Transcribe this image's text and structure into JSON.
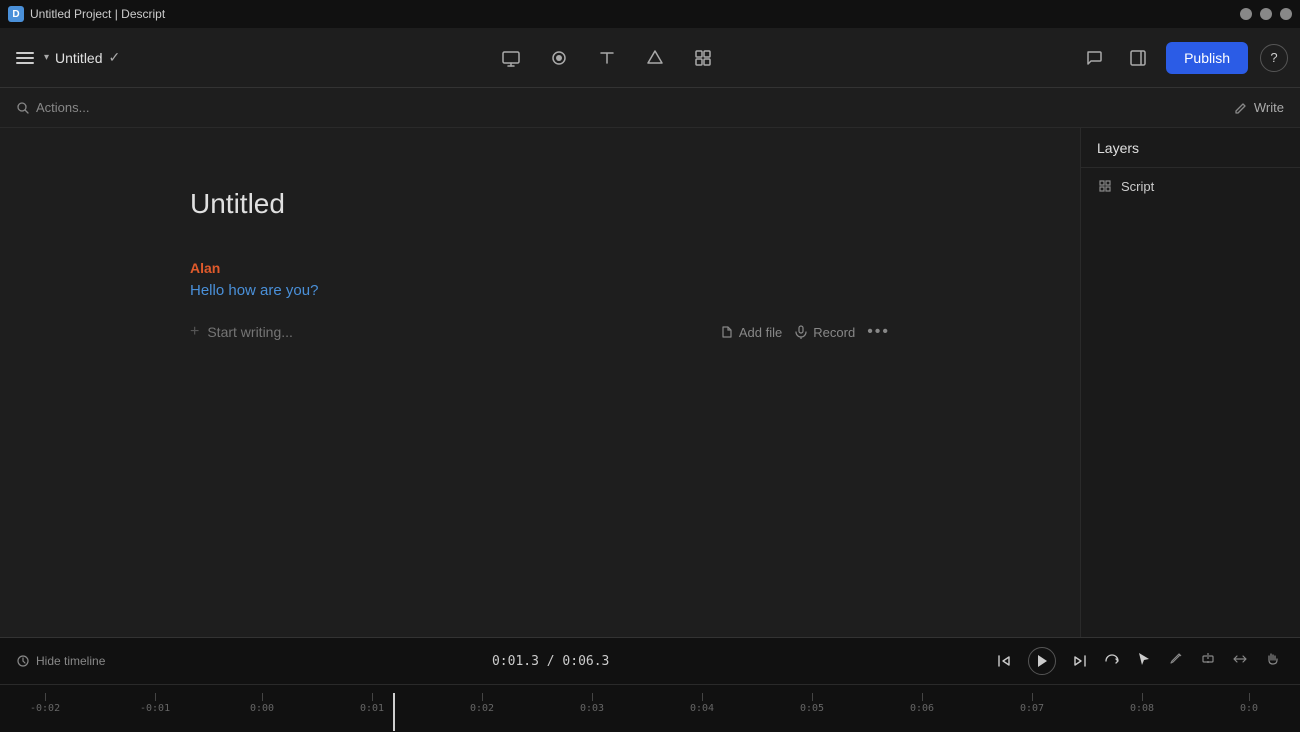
{
  "window": {
    "title": "Untitled Project | Descript",
    "icon_label": "D"
  },
  "toolbar": {
    "project_name": "Untitled",
    "check_icon": "✓",
    "chevron": "▾",
    "publish_label": "Publish",
    "help_label": "?",
    "icons": {
      "camera": "⬛",
      "record": "⏺",
      "text": "T",
      "shape": "◇",
      "grid": "⊞",
      "comment": "💬",
      "panel": "⊡"
    }
  },
  "actions_bar": {
    "search_label": "Actions...",
    "write_label": "Write"
  },
  "editor": {
    "doc_title": "Untitled",
    "speaker_name": "Alan",
    "dialogue": "Hello how are you?",
    "write_placeholder": "Start writing...",
    "add_file_label": "Add file",
    "record_label": "Record",
    "more_label": "•••"
  },
  "right_panel": {
    "layers_label": "Layers",
    "script_label": "Script"
  },
  "timeline": {
    "hide_label": "Hide timeline",
    "current_time": "0:01.3",
    "total_time": "0:06.3",
    "separator": "/",
    "markers": [
      "-0:02",
      "-0:01",
      "0:00",
      "0:01",
      "0:02",
      "0:03",
      "0:04",
      "0:05",
      "0:06",
      "0:07",
      "0:08",
      "0:0"
    ]
  },
  "colors": {
    "accent_blue": "#2b5ce6",
    "speaker_orange": "#e05a2b",
    "dialogue_blue": "#4a90d9",
    "bg_dark": "#1a1a1a",
    "bg_mid": "#1e1e1e",
    "bg_darker": "#111111"
  }
}
